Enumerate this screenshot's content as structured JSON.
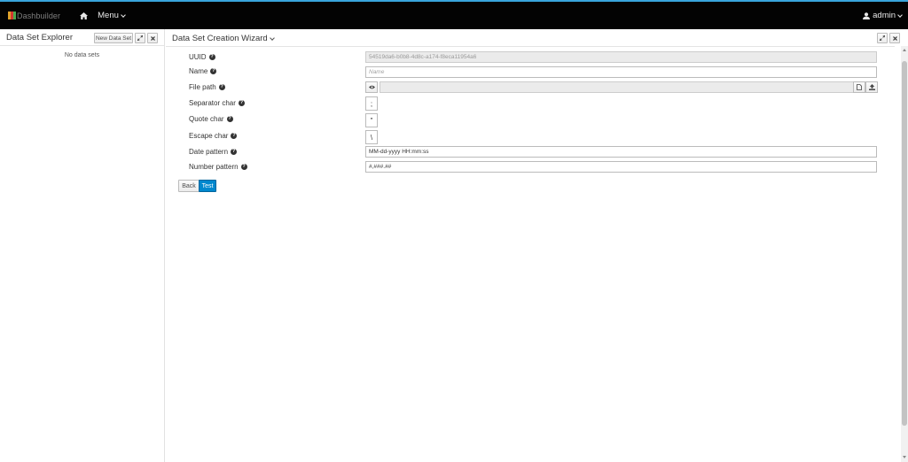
{
  "app": {
    "brand": "Dashbuilder",
    "menu_label": "Menu",
    "user_label": "admin",
    "accent_color": "#39a5dc",
    "primary_color": "#0088ce"
  },
  "explorer": {
    "title": "Data Set Explorer",
    "new_button": "New Data Set",
    "empty_message": "No data sets"
  },
  "wizard": {
    "title": "Data Set Creation Wizard",
    "fields": {
      "uuid": {
        "label": "UUID",
        "value": "54519da6-b0b8-4d8c-a174-f8eca11954a6"
      },
      "name": {
        "label": "Name",
        "placeholder": "Name"
      },
      "file_path": {
        "label": "File path",
        "value": ""
      },
      "separator": {
        "label": "Separator char",
        "value": ";"
      },
      "quote": {
        "label": "Quote char",
        "value": "\""
      },
      "escape": {
        "label": "Escape char",
        "value": "\\"
      },
      "date_pattern": {
        "label": "Date pattern",
        "value": "MM-dd-yyyy HH:mm:ss"
      },
      "number_pattern": {
        "label": "Number pattern",
        "value": "#,###.##"
      }
    },
    "back_button": "Back",
    "test_button": "Test"
  },
  "icons": {
    "home": "home-icon",
    "user": "user-icon",
    "expand": "expand-icon",
    "close": "close-icon",
    "help": "help-icon",
    "eye": "eye-icon",
    "file": "file-icon",
    "upload": "upload-icon"
  }
}
